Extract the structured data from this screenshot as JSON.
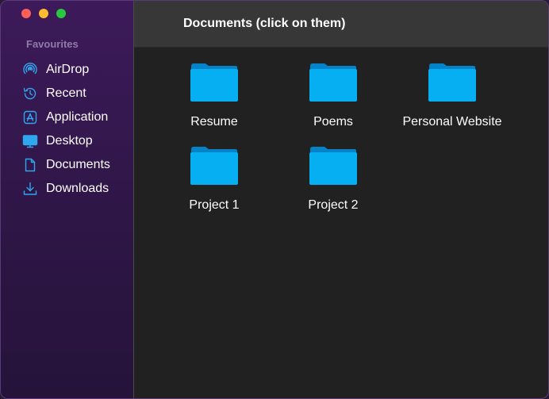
{
  "sidebar": {
    "section_label": "Favourites",
    "items": [
      {
        "label": "AirDrop",
        "icon": "airdrop-icon"
      },
      {
        "label": "Recent",
        "icon": "clock-history-icon"
      },
      {
        "label": "Application",
        "icon": "app-store-icon"
      },
      {
        "label": "Desktop",
        "icon": "monitor-icon"
      },
      {
        "label": "Documents",
        "icon": "document-icon"
      },
      {
        "label": "Downloads",
        "icon": "download-icon"
      }
    ]
  },
  "header": {
    "title": "Documents (click on them)"
  },
  "folders": [
    {
      "label": "Resume",
      "icon": "folder-icon"
    },
    {
      "label": "Poems",
      "icon": "folder-icon"
    },
    {
      "label": "Personal Website",
      "icon": "folder-icon"
    },
    {
      "label": "Project 1",
      "icon": "folder-icon"
    },
    {
      "label": "Project 2",
      "icon": "folder-icon"
    }
  ],
  "colors": {
    "accent": "#0ea5e9",
    "folder_body": "#06aef2",
    "folder_tab": "#0583c8",
    "sidebar_top": "#3d1a5a",
    "content_bg": "#212121"
  }
}
